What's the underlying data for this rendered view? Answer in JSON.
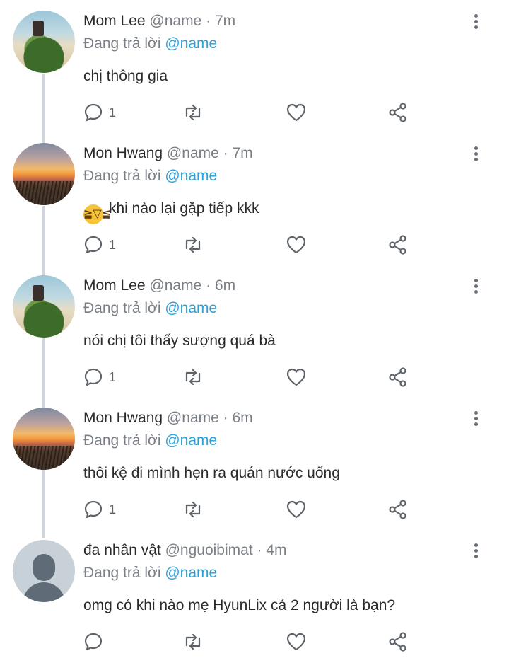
{
  "reply_prefix": "Đang trả lời",
  "posts": [
    {
      "name": "Mom Lee",
      "handle": "@name",
      "dot": "·",
      "time": "7m",
      "reply_to": "@name",
      "text": "chị thông gia",
      "emoji": "",
      "reply_count": "1",
      "avatar": "coconut-photo"
    },
    {
      "name": "Mon Hwang",
      "handle": "@name",
      "dot": "·",
      "time": "7m",
      "reply_to": "@name",
      "text": "khi nào lại gặp tiếp kkk",
      "emoji": "laughing-emoji",
      "reply_count": "1",
      "avatar": "sunset-photo"
    },
    {
      "name": "Mom Lee",
      "handle": "@name",
      "dot": "·",
      "time": "6m",
      "reply_to": "@name",
      "text": "nói chị tôi thấy sượng quá bà",
      "emoji": "",
      "reply_count": "1",
      "avatar": "coconut-photo"
    },
    {
      "name": "Mon Hwang",
      "handle": "@name",
      "dot": "·",
      "time": "6m",
      "reply_to": "@name",
      "text": "thôi kệ đi mình hẹn ra quán nước uống",
      "emoji": "",
      "reply_count": "1",
      "avatar": "sunset-photo"
    },
    {
      "name": "đa nhân vật",
      "handle": "@nguoibimat",
      "dot": "·",
      "time": "4m",
      "reply_to": "@name",
      "text": "omg có khi nào mẹ HyunLix cả 2 người là bạn?",
      "emoji": "",
      "reply_count": "",
      "avatar": "default-avatar"
    }
  ],
  "icons": {
    "reply": "reply-icon",
    "retweet": "retweet-icon",
    "like": "heart-icon",
    "share": "share-icon",
    "more": "more-vertical-icon"
  },
  "colors": {
    "mention": "#2aa0d8",
    "muted": "#7a7f86",
    "thread_line": "#cfd5da"
  }
}
